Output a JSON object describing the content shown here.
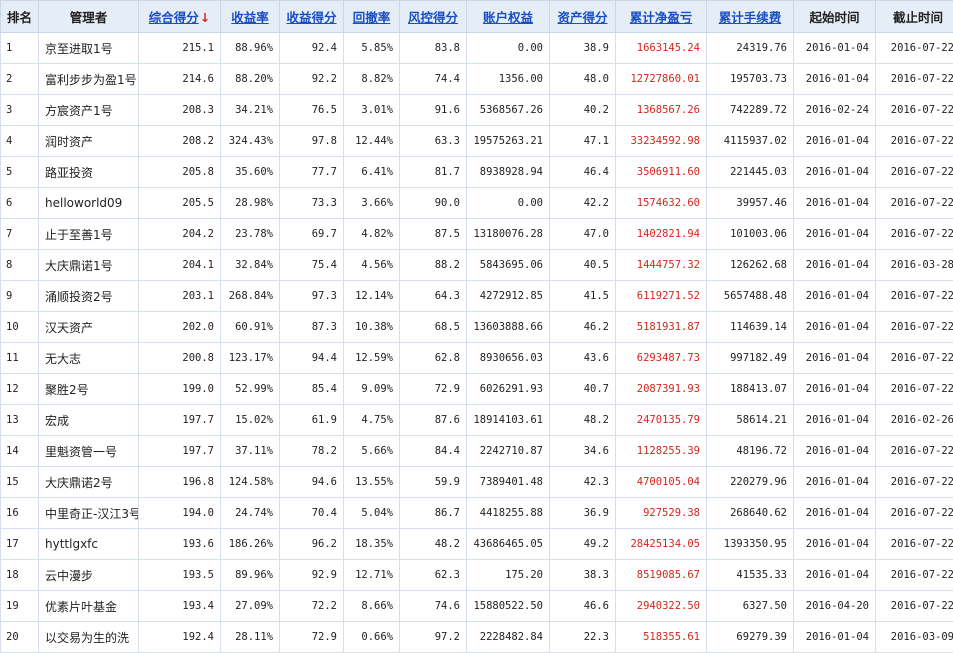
{
  "headers": {
    "rank": "排名",
    "manager": "管理者",
    "composite": "综合得分",
    "sort_arrow": "↓",
    "return_rate": "收益率",
    "return_score": "收益得分",
    "drawdown": "回撤率",
    "risk_score": "风控得分",
    "equity": "账户权益",
    "asset_score": "资产得分",
    "cum_pnl": "累计净盈亏",
    "cum_fee": "累计手续费",
    "start_time": "起始时间",
    "end_time": "截止时间"
  },
  "colors": {
    "header_bg": "#e5edf7",
    "link": "#1a4fc4",
    "pnl_red": "#d0271d",
    "arrow_red": "#e0201c"
  },
  "rows": [
    {
      "rank": "1",
      "manager": "京至进取1号",
      "composite": "215.1",
      "return_rate": "88.96%",
      "return_score": "92.4",
      "drawdown": "5.85%",
      "risk_score": "83.8",
      "equity": "0.00",
      "asset_score": "38.9",
      "cum_pnl": "1663145.24",
      "cum_fee": "24319.76",
      "start": "2016-01-04",
      "end": "2016-07-22"
    },
    {
      "rank": "2",
      "manager": "富利步步为盈1号",
      "composite": "214.6",
      "return_rate": "88.20%",
      "return_score": "92.2",
      "drawdown": "8.82%",
      "risk_score": "74.4",
      "equity": "1356.00",
      "asset_score": "48.0",
      "cum_pnl": "12727860.01",
      "cum_fee": "195703.73",
      "start": "2016-01-04",
      "end": "2016-07-22"
    },
    {
      "rank": "3",
      "manager": "方宸资产1号",
      "composite": "208.3",
      "return_rate": "34.21%",
      "return_score": "76.5",
      "drawdown": "3.01%",
      "risk_score": "91.6",
      "equity": "5368567.26",
      "asset_score": "40.2",
      "cum_pnl": "1368567.26",
      "cum_fee": "742289.72",
      "start": "2016-02-24",
      "end": "2016-07-22"
    },
    {
      "rank": "4",
      "manager": "润时资产",
      "composite": "208.2",
      "return_rate": "324.43%",
      "return_score": "97.8",
      "drawdown": "12.44%",
      "risk_score": "63.3",
      "equity": "19575263.21",
      "asset_score": "47.1",
      "cum_pnl": "33234592.98",
      "cum_fee": "4115937.02",
      "start": "2016-01-04",
      "end": "2016-07-22"
    },
    {
      "rank": "5",
      "manager": "路亚投资",
      "composite": "205.8",
      "return_rate": "35.60%",
      "return_score": "77.7",
      "drawdown": "6.41%",
      "risk_score": "81.7",
      "equity": "8938928.94",
      "asset_score": "46.4",
      "cum_pnl": "3506911.60",
      "cum_fee": "221445.03",
      "start": "2016-01-04",
      "end": "2016-07-22"
    },
    {
      "rank": "6",
      "manager": "helloworld09",
      "composite": "205.5",
      "return_rate": "28.98%",
      "return_score": "73.3",
      "drawdown": "3.66%",
      "risk_score": "90.0",
      "equity": "0.00",
      "asset_score": "42.2",
      "cum_pnl": "1574632.60",
      "cum_fee": "39957.46",
      "start": "2016-01-04",
      "end": "2016-07-22"
    },
    {
      "rank": "7",
      "manager": "止于至善1号",
      "composite": "204.2",
      "return_rate": "23.78%",
      "return_score": "69.7",
      "drawdown": "4.82%",
      "risk_score": "87.5",
      "equity": "13180076.28",
      "asset_score": "47.0",
      "cum_pnl": "1402821.94",
      "cum_fee": "101003.06",
      "start": "2016-01-04",
      "end": "2016-07-22"
    },
    {
      "rank": "8",
      "manager": "大庆鼎诺1号",
      "composite": "204.1",
      "return_rate": "32.84%",
      "return_score": "75.4",
      "drawdown": "4.56%",
      "risk_score": "88.2",
      "equity": "5843695.06",
      "asset_score": "40.5",
      "cum_pnl": "1444757.32",
      "cum_fee": "126262.68",
      "start": "2016-01-04",
      "end": "2016-03-28"
    },
    {
      "rank": "9",
      "manager": "涌顺投资2号",
      "composite": "203.1",
      "return_rate": "268.84%",
      "return_score": "97.3",
      "drawdown": "12.14%",
      "risk_score": "64.3",
      "equity": "4272912.85",
      "asset_score": "41.5",
      "cum_pnl": "6119271.52",
      "cum_fee": "5657488.48",
      "start": "2016-01-04",
      "end": "2016-07-22"
    },
    {
      "rank": "10",
      "manager": "汉天资产",
      "composite": "202.0",
      "return_rate": "60.91%",
      "return_score": "87.3",
      "drawdown": "10.38%",
      "risk_score": "68.5",
      "equity": "13603888.66",
      "asset_score": "46.2",
      "cum_pnl": "5181931.87",
      "cum_fee": "114639.14",
      "start": "2016-01-04",
      "end": "2016-07-22"
    },
    {
      "rank": "11",
      "manager": "无大志",
      "composite": "200.8",
      "return_rate": "123.17%",
      "return_score": "94.4",
      "drawdown": "12.59%",
      "risk_score": "62.8",
      "equity": "8930656.03",
      "asset_score": "43.6",
      "cum_pnl": "6293487.73",
      "cum_fee": "997182.49",
      "start": "2016-01-04",
      "end": "2016-07-22"
    },
    {
      "rank": "12",
      "manager": "聚胜2号",
      "composite": "199.0",
      "return_rate": "52.99%",
      "return_score": "85.4",
      "drawdown": "9.09%",
      "risk_score": "72.9",
      "equity": "6026291.93",
      "asset_score": "40.7",
      "cum_pnl": "2087391.93",
      "cum_fee": "188413.07",
      "start": "2016-01-04",
      "end": "2016-07-22"
    },
    {
      "rank": "13",
      "manager": "宏成",
      "composite": "197.7",
      "return_rate": "15.02%",
      "return_score": "61.9",
      "drawdown": "4.75%",
      "risk_score": "87.6",
      "equity": "18914103.61",
      "asset_score": "48.2",
      "cum_pnl": "2470135.79",
      "cum_fee": "58614.21",
      "start": "2016-01-04",
      "end": "2016-02-26"
    },
    {
      "rank": "14",
      "manager": "里魁资管一号",
      "composite": "197.7",
      "return_rate": "37.11%",
      "return_score": "78.2",
      "drawdown": "5.66%",
      "risk_score": "84.4",
      "equity": "2242710.87",
      "asset_score": "34.6",
      "cum_pnl": "1128255.39",
      "cum_fee": "48196.72",
      "start": "2016-01-04",
      "end": "2016-07-22"
    },
    {
      "rank": "15",
      "manager": "大庆鼎诺2号",
      "composite": "196.8",
      "return_rate": "124.58%",
      "return_score": "94.6",
      "drawdown": "13.55%",
      "risk_score": "59.9",
      "equity": "7389401.48",
      "asset_score": "42.3",
      "cum_pnl": "4700105.04",
      "cum_fee": "220279.96",
      "start": "2016-01-04",
      "end": "2016-07-22"
    },
    {
      "rank": "16",
      "manager": "中里奇正-汉江3号",
      "composite": "194.0",
      "return_rate": "24.74%",
      "return_score": "70.4",
      "drawdown": "5.04%",
      "risk_score": "86.7",
      "equity": "4418255.88",
      "asset_score": "36.9",
      "cum_pnl": "927529.38",
      "cum_fee": "268640.62",
      "start": "2016-01-04",
      "end": "2016-07-22"
    },
    {
      "rank": "17",
      "manager": "hyttlgxfc",
      "composite": "193.6",
      "return_rate": "186.26%",
      "return_score": "96.2",
      "drawdown": "18.35%",
      "risk_score": "48.2",
      "equity": "43686465.05",
      "asset_score": "49.2",
      "cum_pnl": "28425134.05",
      "cum_fee": "1393350.95",
      "start": "2016-01-04",
      "end": "2016-07-22"
    },
    {
      "rank": "18",
      "manager": "云中漫步",
      "composite": "193.5",
      "return_rate": "89.96%",
      "return_score": "92.9",
      "drawdown": "12.71%",
      "risk_score": "62.3",
      "equity": "175.20",
      "asset_score": "38.3",
      "cum_pnl": "8519085.67",
      "cum_fee": "41535.33",
      "start": "2016-01-04",
      "end": "2016-07-22"
    },
    {
      "rank": "19",
      "manager": "优素片叶基金",
      "composite": "193.4",
      "return_rate": "27.09%",
      "return_score": "72.2",
      "drawdown": "8.66%",
      "risk_score": "74.6",
      "equity": "15880522.50",
      "asset_score": "46.6",
      "cum_pnl": "2940322.50",
      "cum_fee": "6327.50",
      "start": "2016-04-20",
      "end": "2016-07-22"
    },
    {
      "rank": "20",
      "manager": "以交易为生的洗",
      "composite": "192.4",
      "return_rate": "28.11%",
      "return_score": "72.9",
      "drawdown": "0.66%",
      "risk_score": "97.2",
      "equity": "2228482.84",
      "asset_score": "22.3",
      "cum_pnl": "518355.61",
      "cum_fee": "69279.39",
      "start": "2016-01-04",
      "end": "2016-03-09"
    }
  ]
}
